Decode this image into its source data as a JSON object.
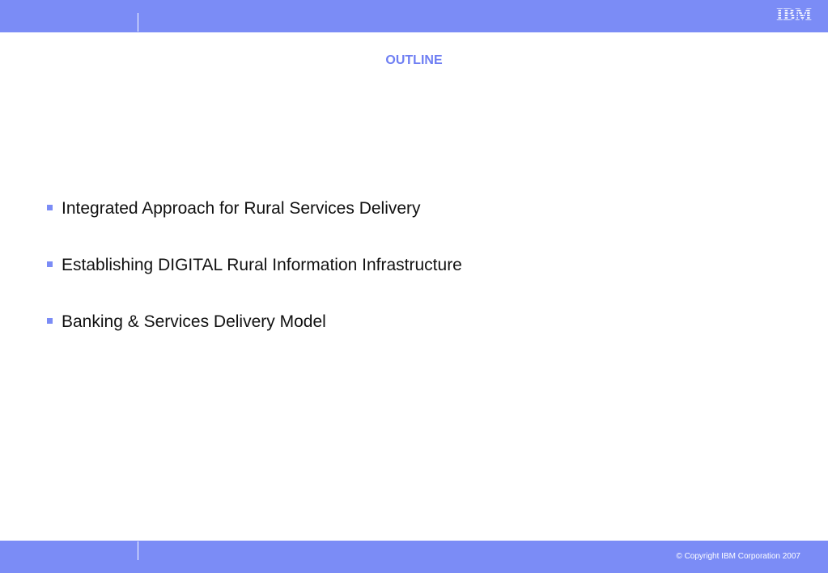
{
  "header": {
    "logo_text": "IBM"
  },
  "slide": {
    "title": "OUTLINE",
    "bullets": [
      "Integrated Approach for Rural Services Delivery",
      "Establishing DIGITAL Rural Information Infrastructure",
      "Banking & Services Delivery Model"
    ]
  },
  "footer": {
    "copyright": "© Copyright IBM Corporation 2007"
  },
  "colors": {
    "bar": "#7b8cf6",
    "title": "#6f7ff3"
  }
}
